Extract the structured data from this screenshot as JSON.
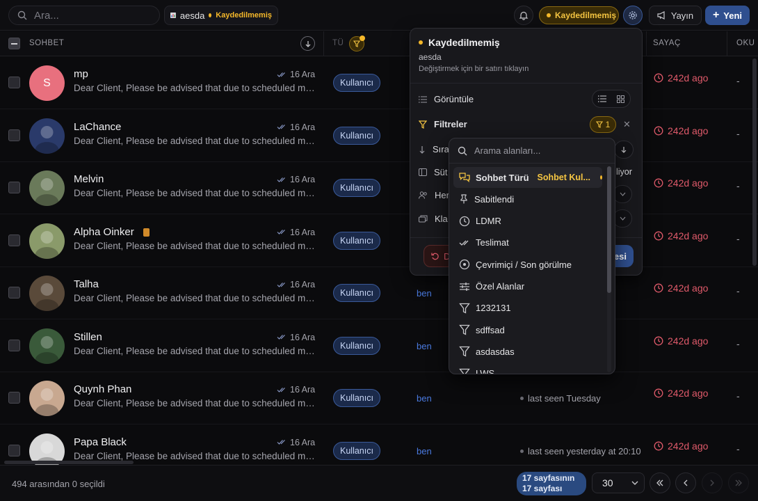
{
  "topbar": {
    "search_placeholder": "Ara...",
    "view_name": "aesda",
    "view_status": "Kaydedilmemiş",
    "unsaved_label": "Kaydedilmemiş",
    "broadcast_label": "Yayın",
    "new_label": "Yeni"
  },
  "table": {
    "columns": {
      "chat": "SOHBET",
      "type_abbrev": "TÜ",
      "counter": "SAYAÇ",
      "read": "OKU"
    },
    "rows": [
      {
        "name": "mp",
        "preview": "Dear Client, Please be advised that due to scheduled maintenance",
        "date": "16 Ara",
        "type": "Kullanıcı",
        "avatar_letter": "S",
        "avatar_color": "#e8707e",
        "assignee": "",
        "seen": "",
        "counter": "242d ago",
        "read": "-"
      },
      {
        "name": "LaChance",
        "preview": "Dear Client, Please be advised that due to scheduled maintenance",
        "date": "16 Ara",
        "type": "Kullanıcı",
        "avatar_letter": "",
        "avatar_color": "#2a3a6a",
        "assignee": "",
        "seen": "",
        "counter": "242d ago",
        "read": "-"
      },
      {
        "name": "Melvin",
        "preview": "Dear Client, Please be advised that due to scheduled maintenance",
        "date": "16 Ara",
        "type": "Kullanıcı",
        "avatar_letter": "",
        "avatar_color": "#6a7a5a",
        "assignee": "",
        "seen": "",
        "counter": "242d ago",
        "read": "-"
      },
      {
        "name": "Alpha Oinker",
        "preview": "Dear Client, Please be advised that due to scheduled maintenance",
        "date": "16 Ara",
        "type": "Kullanıcı",
        "avatar_letter": "",
        "avatar_color": "#8a9a6a",
        "assignee": "",
        "seen": "",
        "counter": "242d ago",
        "read": "-"
      },
      {
        "name": "Talha",
        "preview": "Dear Client, Please be advised that due to scheduled maintenance",
        "date": "16 Ara",
        "type": "Kullanıcı",
        "avatar_letter": "",
        "avatar_color": "#5a4a3a",
        "assignee": "ben",
        "seen": "",
        "counter": "242d ago",
        "read": "-"
      },
      {
        "name": "Stillen",
        "preview": "Dear Client, Please be advised that due to scheduled maintenance",
        "date": "16 Ara",
        "type": "Kullanıcı",
        "avatar_letter": "",
        "avatar_color": "#3a5a3a",
        "assignee": "ben",
        "seen": "",
        "counter": "242d ago",
        "read": "-"
      },
      {
        "name": "Quynh Phan",
        "preview": "Dear Client, Please be advised that due to scheduled maintenance",
        "date": "16 Ara",
        "type": "Kullanıcı",
        "avatar_letter": "",
        "avatar_color": "#c8a890",
        "assignee": "ben",
        "seen": "last seen Tuesday",
        "counter": "242d ago",
        "read": "-"
      },
      {
        "name": "Papa Black",
        "preview": "Dear Client, Please be advised that due to scheduled maintenance",
        "date": "16 Ara",
        "type": "Kullanıcı",
        "avatar_letter": "",
        "avatar_color": "#d8d8d8",
        "assignee": "ben",
        "seen": "last seen yesterday at 20:10",
        "counter": "242d ago",
        "read": "-"
      }
    ]
  },
  "footer": {
    "selection": "494 arasından 0 seçildi",
    "page_line1": "17 sayfasının",
    "page_line2": "17 sayfası",
    "per_page": "30"
  },
  "panel": {
    "title": "Kaydedilmemiş",
    "view_name": "aesda",
    "hint": "Değiştirmek için bir satırı tıklayın",
    "display_label": "Görüntüle",
    "filters_label": "Filtreler",
    "filter_count": "1",
    "sort_label_partial": "Sıra",
    "columns_label_partial": "Süt",
    "columns_value_partial": "liyor",
    "everyone_label_partial": "Her",
    "folder_label_partial": "Kla",
    "reset_label_partial": "D",
    "save_label_partial": "esi"
  },
  "dropdown": {
    "search_placeholder": "Arama alanları...",
    "items": [
      {
        "label": "Sohbet Türü",
        "tag": "Sohbet Kul...",
        "icon": "chat-bubbles-icon"
      },
      {
        "label": "Sabitlendi",
        "tag": "",
        "icon": "pin-icon"
      },
      {
        "label": "LDMR",
        "tag": "",
        "icon": "clock-icon"
      },
      {
        "label": "Teslimat",
        "tag": "",
        "icon": "double-check-icon"
      },
      {
        "label": "Çevrimiçi / Son görülme",
        "tag": "",
        "icon": "presence-icon"
      },
      {
        "label": "Özel Alanlar",
        "tag": "",
        "icon": "sliders-icon"
      },
      {
        "label": "1232131",
        "tag": "",
        "icon": "filter-icon"
      },
      {
        "label": "sdffsad",
        "tag": "",
        "icon": "filter-icon"
      },
      {
        "label": "asdasdas",
        "tag": "",
        "icon": "filter-icon"
      },
      {
        "label": "LWS",
        "tag": "",
        "icon": "filter-icon"
      }
    ]
  },
  "colors": {
    "accent_blue": "#2f4f8f",
    "warning_amber": "#f5b82a",
    "counter_red": "#e05a6a"
  }
}
